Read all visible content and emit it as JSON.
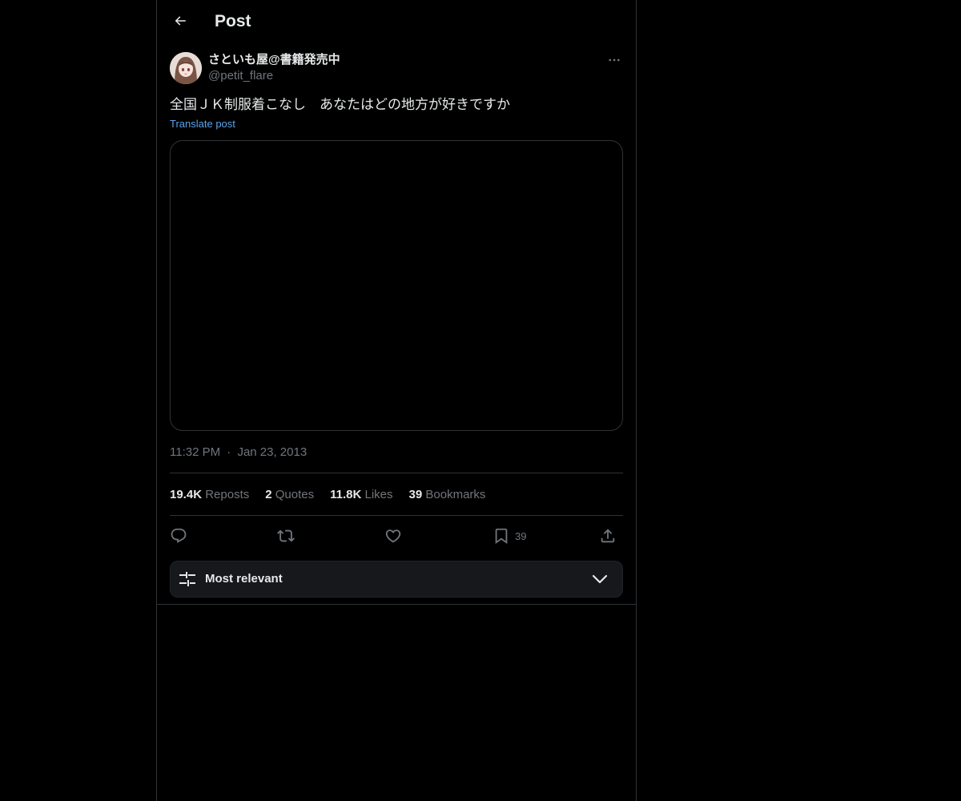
{
  "header": {
    "back_icon": "arrow-left-icon",
    "title": "Post"
  },
  "author": {
    "display_name": "さといも屋@書籍発売中",
    "handle": "@petit_flare",
    "avatar_icon": "avatar-icon",
    "more_icon": "more-horizontal-icon"
  },
  "post": {
    "text": "全国ＪＫ制服着こなし　あなたはどの地方が好きですか",
    "translate_label": "Translate post",
    "time": "11:32 PM",
    "separator": "·",
    "date": "Jan 23, 2013"
  },
  "stats": {
    "reposts_count": "19.4K",
    "reposts_label": "Reposts",
    "quotes_count": "2",
    "quotes_label": "Quotes",
    "likes_count": "11.8K",
    "likes_label": "Likes",
    "bookmarks_count": "39",
    "bookmarks_label": "Bookmarks"
  },
  "actions": {
    "reply_icon": "reply-icon",
    "repost_icon": "repost-icon",
    "like_icon": "heart-icon",
    "bookmark_icon": "bookmark-icon",
    "bookmark_count": "39",
    "share_icon": "share-icon"
  },
  "sort": {
    "label": "Most relevant",
    "icon": "sliders-icon",
    "chevron": "chevron-down-icon"
  },
  "colors": {
    "background": "#000000",
    "border": "#2f3336",
    "text_primary": "#e7e9ea",
    "text_secondary": "#71767b",
    "link": "#5ba3e8",
    "sort_bar_bg": "#16181c"
  }
}
